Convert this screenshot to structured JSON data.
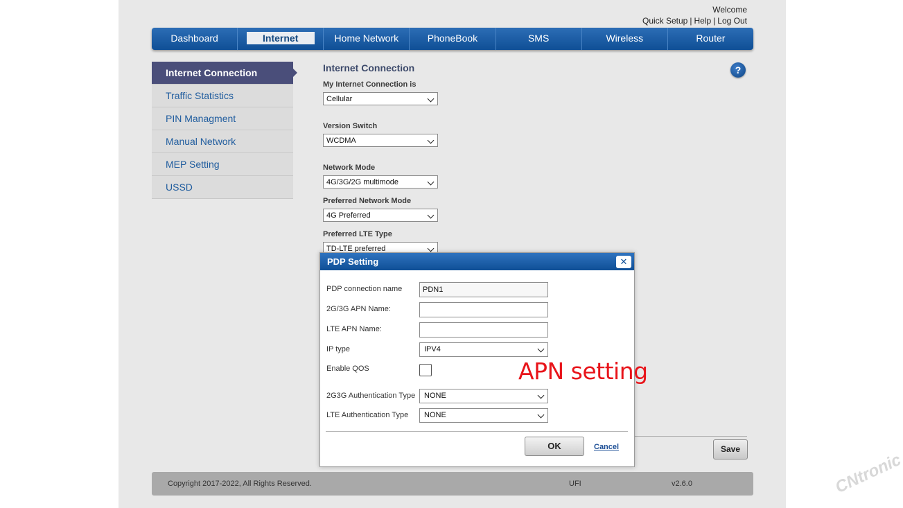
{
  "header": {
    "welcome": "Welcome",
    "quick_setup": "Quick Setup",
    "help": "Help",
    "logout": "Log Out",
    "separator": "|"
  },
  "nav": {
    "tabs": [
      "Dashboard",
      "Internet",
      "Home Network",
      "PhoneBook",
      "SMS",
      "Wireless",
      "Router"
    ],
    "active": "Internet"
  },
  "sidebar": {
    "items": [
      "Internet Connection",
      "Traffic Statistics",
      "PIN Managment",
      "Manual Network",
      "MEP Setting",
      "USSD"
    ],
    "active": "Internet Connection"
  },
  "main": {
    "title": "Internet Connection",
    "help_icon": "?",
    "fields": [
      {
        "label": "My Internet Connection is",
        "value": "Cellular"
      },
      {
        "label": "Version Switch",
        "value": "WCDMA"
      },
      {
        "label": "Network Mode",
        "value": "4G/3G/2G multimode"
      },
      {
        "label": "Preferred Network Mode",
        "value": "4G Preferred"
      },
      {
        "label": "Preferred LTE Type",
        "value": "TD-LTE preferred"
      }
    ],
    "save_label": "Save"
  },
  "dialog": {
    "title": "PDP Setting",
    "close_icon": "✕",
    "pdp_name_label": "PDP connection name",
    "pdp_name_value": "PDN1",
    "apn_2g3g_label": "2G/3G APN Name:",
    "apn_2g3g_value": "",
    "lte_apn_label": "LTE APN Name:",
    "lte_apn_value": "",
    "ip_type_label": "IP type",
    "ip_type_value": "IPV4",
    "qos_label": "Enable QOS",
    "qos_checked": false,
    "auth_2g3g_label": "2G3G Authentication Type",
    "auth_2g3g_value": "NONE",
    "lte_auth_label": "LTE Authentication Type",
    "lte_auth_value": "NONE",
    "ok_label": "OK",
    "cancel_label": "Cancel"
  },
  "annotation": "APN setting",
  "footer": {
    "copyright": "Copyright 2017-2022, All Rights Reserved.",
    "device": "UFI",
    "version": "v2.6.0"
  },
  "watermark": "CNtronic",
  "colors": {
    "nav_blue": "#0f4f96",
    "sidebar_active": "#4a4e7a",
    "annotation_red": "#e8141a"
  }
}
